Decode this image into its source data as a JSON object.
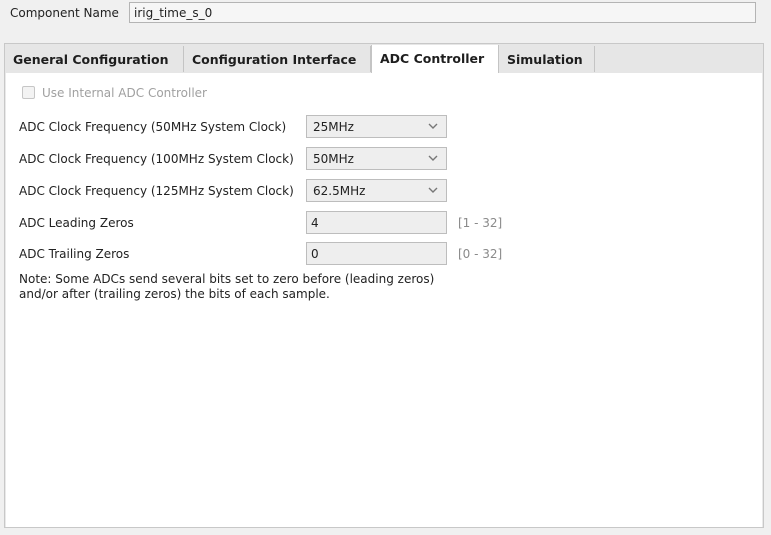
{
  "component": {
    "label": "Component Name",
    "value": "irig_time_s_0"
  },
  "tabs": [
    {
      "label": "General Configuration",
      "active": false
    },
    {
      "label": "Configuration Interface",
      "active": false
    },
    {
      "label": "ADC Controller",
      "active": true
    },
    {
      "label": "Simulation",
      "active": false
    }
  ],
  "adc": {
    "use_internal": {
      "label": "Use Internal ADC Controller",
      "checked": false,
      "enabled": false
    },
    "clock_50": {
      "label": "ADC Clock Frequency (50MHz System Clock)",
      "value": "25MHz"
    },
    "clock_100": {
      "label": "ADC Clock Frequency (100MHz System Clock)",
      "value": "50MHz"
    },
    "clock_125": {
      "label": "ADC Clock Frequency (125MHz System Clock)",
      "value": "62.5MHz"
    },
    "leading": {
      "label": "ADC Leading Zeros",
      "value": "4",
      "range": "[1 - 32]"
    },
    "trailing": {
      "label": "ADC Trailing Zeros",
      "value": "0",
      "range": "[0 - 32]"
    },
    "note_line1": "Note: Some ADCs send several bits set to zero before (leading zeros)",
    "note_line2": "and/or after (trailing zeros) the bits of each sample."
  },
  "colors": {
    "background": "#f0f0f0",
    "tab_active": "#ffffff",
    "disabled_text": "#a0a0a0",
    "range_text": "#8a8a8a"
  }
}
